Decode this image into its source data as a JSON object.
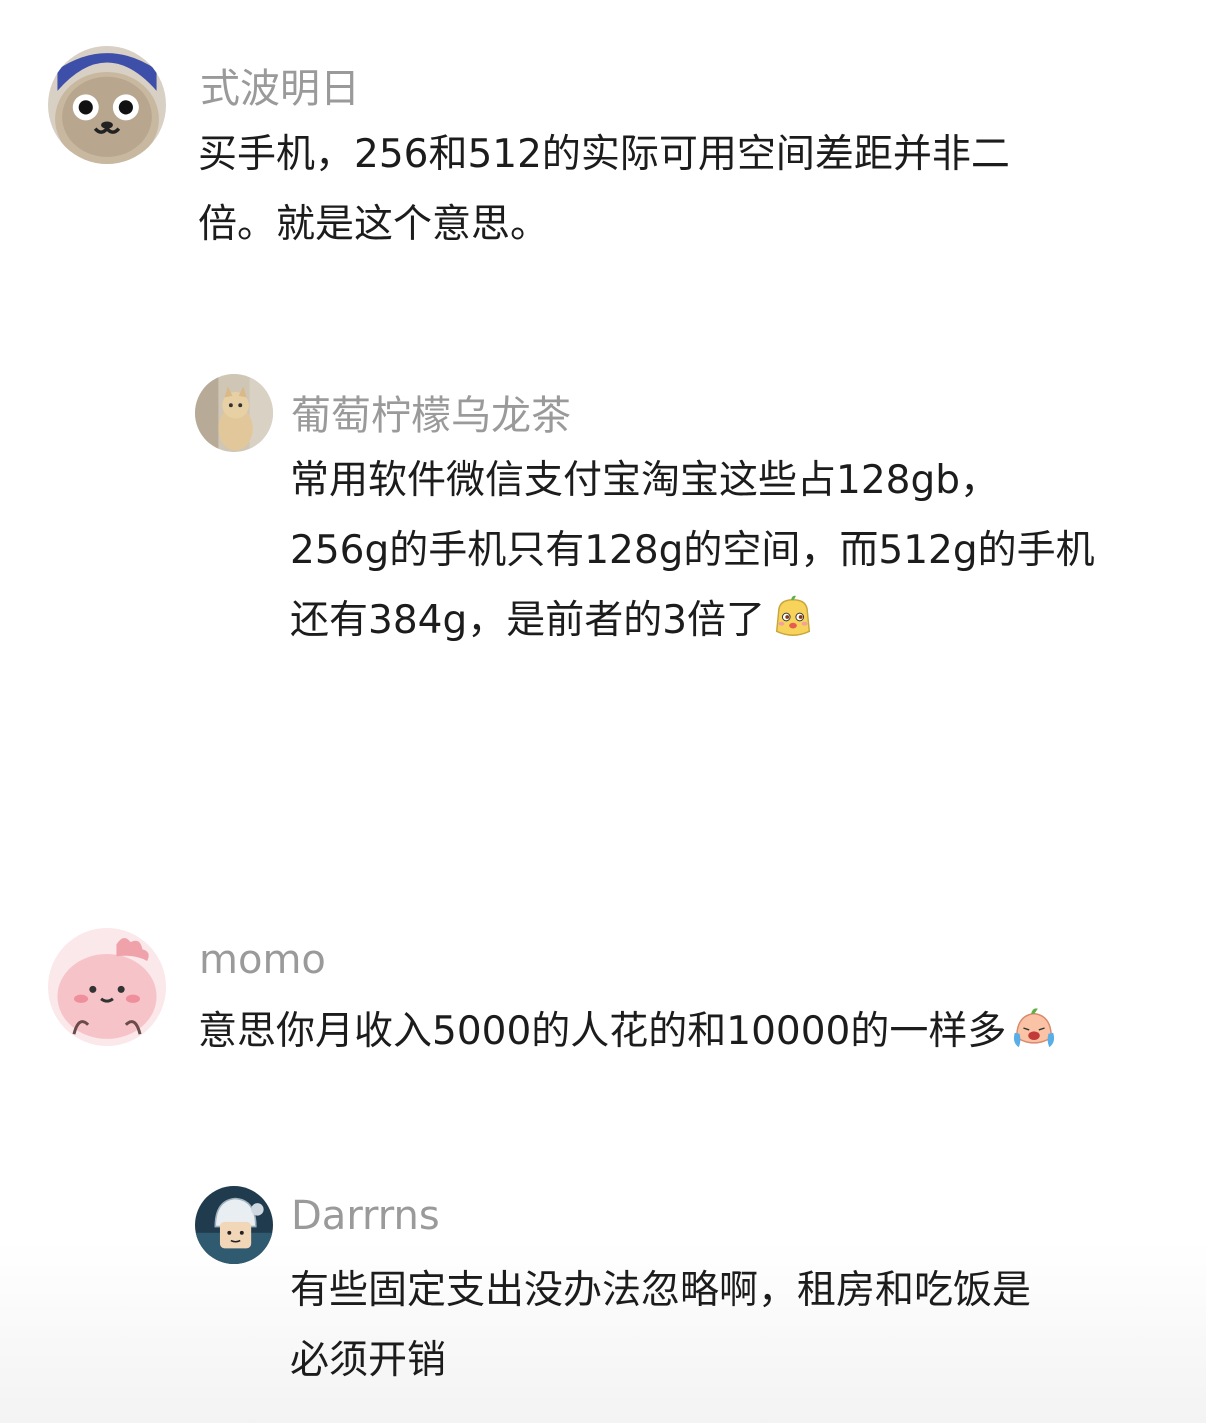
{
  "comments": [
    {
      "user": "式波明日",
      "avatar": "round-face-creature-avatar",
      "lines": [
        "买手机，256和512的实际可用空间差距并非二",
        "倍。就是这个意思。"
      ]
    },
    {
      "user": "葡萄柠檬乌龙茶",
      "avatar": "cat-photo-avatar",
      "lines": [
        "常用软件微信支付宝淘宝这些占128gb，",
        "256g的手机只有128g的空间，而512g的手机",
        "还有384g，是前者的3倍了"
      ],
      "emoji": "smug-dog-emoji"
    },
    {
      "user": "momo",
      "avatar": "pink-blob-avatar",
      "lines": [
        "意思你月收入5000的人花的和10000的一样多"
      ],
      "emoji": "crying-face-emoji"
    },
    {
      "user": "Darrrns",
      "avatar": "helmet-character-avatar",
      "lines": [
        "有些固定支出没办法忽略啊，租房和吃饭是",
        "必须开销"
      ]
    }
  ],
  "colors": {
    "username": "#9a9a9a",
    "text": "#1c1c1c",
    "background": "#ffffff"
  }
}
